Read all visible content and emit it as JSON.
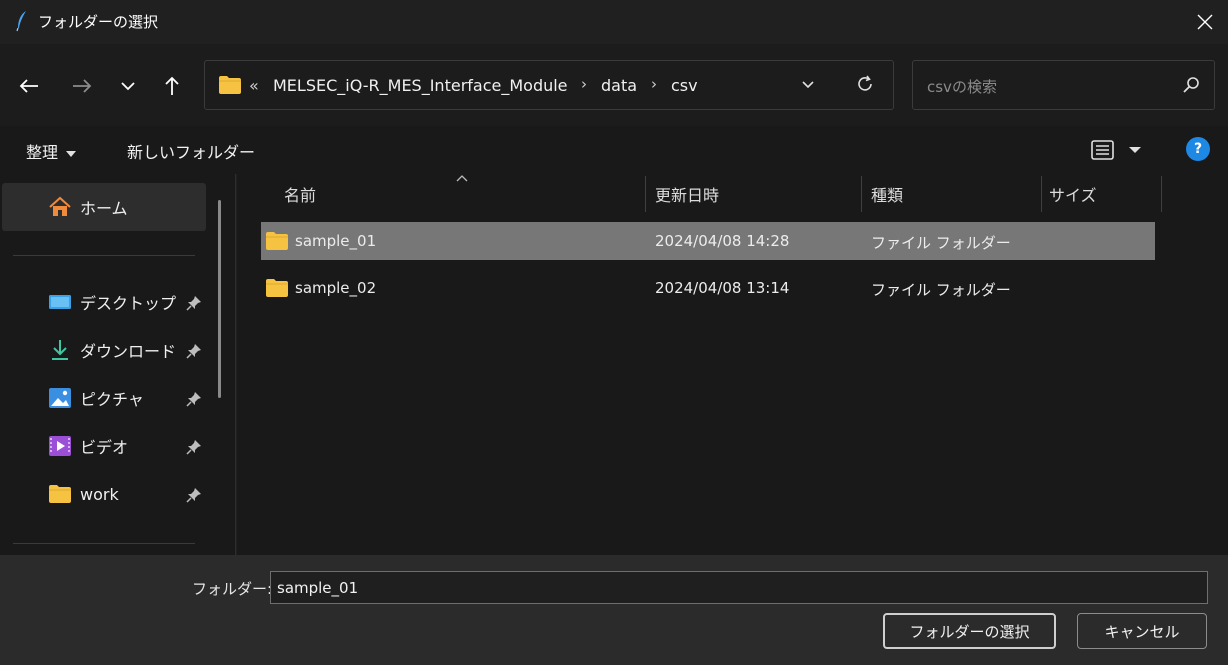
{
  "window": {
    "title": "フォルダーの選択",
    "close_icon": "close-icon"
  },
  "nav": {
    "back_icon": "arrow-left-icon",
    "forward_icon": "arrow-right-icon",
    "recent_icon": "chevron-down-icon",
    "up_icon": "arrow-up-icon"
  },
  "address": {
    "overflow": "«",
    "segments": [
      "MELSEC_iQ-R_MES_Interface_Module",
      "data",
      "csv"
    ],
    "separator": "›"
  },
  "search": {
    "placeholder": "csvの検索"
  },
  "toolbar": {
    "organize": "整理",
    "new_folder": "新しいフォルダー",
    "help": "?"
  },
  "sidebar": {
    "home": "ホーム",
    "items": [
      {
        "label": "デスクトップ",
        "icon": "desktop-icon"
      },
      {
        "label": "ダウンロード",
        "icon": "download-icon"
      },
      {
        "label": "ピクチャ",
        "icon": "pictures-icon"
      },
      {
        "label": "ビデオ",
        "icon": "video-icon"
      },
      {
        "label": "work",
        "icon": "folder-icon"
      }
    ]
  },
  "columns": {
    "name": "名前",
    "modified": "更新日時",
    "type": "種類",
    "size": "サイズ"
  },
  "files": [
    {
      "name": "sample_01",
      "modified": "2024/04/08 14:28",
      "type": "ファイル フォルダー",
      "selected": true
    },
    {
      "name": "sample_02",
      "modified": "2024/04/08 13:14",
      "type": "ファイル フォルダー",
      "selected": false
    }
  ],
  "footer": {
    "folder_label": "フォルダー:",
    "folder_value": "sample_01",
    "select_button": "フォルダーの選択",
    "cancel_button": "キャンセル"
  },
  "colors": {
    "accent": "#1e88e5",
    "folder": "#f5c242",
    "selected_row": "#777777"
  }
}
